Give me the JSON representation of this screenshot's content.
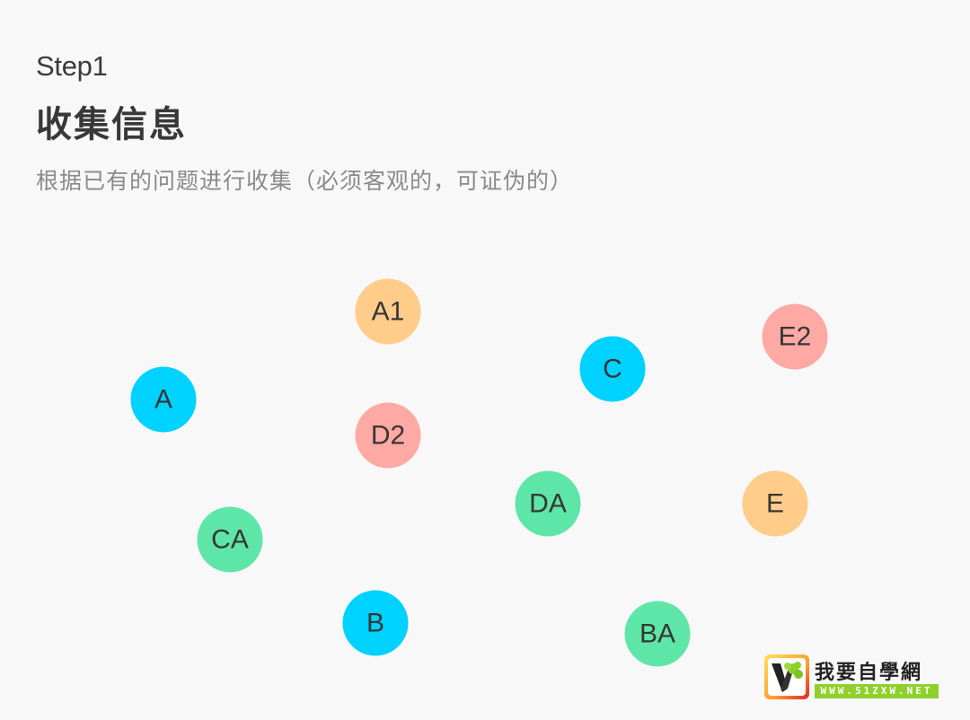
{
  "header": {
    "step": "Step1",
    "title": "收集信息",
    "subtitle": "根据已有的问题进行收集（必须客观的，可证伪的）"
  },
  "colors": {
    "cyan": "#00D2FF",
    "orange": "#FFCC8A",
    "pink": "#FFA9A4",
    "green": "#5EE6A8",
    "text": "#363636",
    "background": "#F8F8F8"
  },
  "nodes": [
    {
      "label": "A1",
      "color": "orange"
    },
    {
      "label": "E2",
      "color": "pink"
    },
    {
      "label": "C",
      "color": "cyan"
    },
    {
      "label": "A",
      "color": "cyan"
    },
    {
      "label": "D2",
      "color": "pink"
    },
    {
      "label": "DA",
      "color": "green"
    },
    {
      "label": "E",
      "color": "orange"
    },
    {
      "label": "CA",
      "color": "green"
    },
    {
      "label": "B",
      "color": "cyan"
    },
    {
      "label": "BA",
      "color": "green"
    }
  ],
  "watermark": {
    "name": "我要自學網",
    "url": "WWW.51ZXW.NET"
  }
}
